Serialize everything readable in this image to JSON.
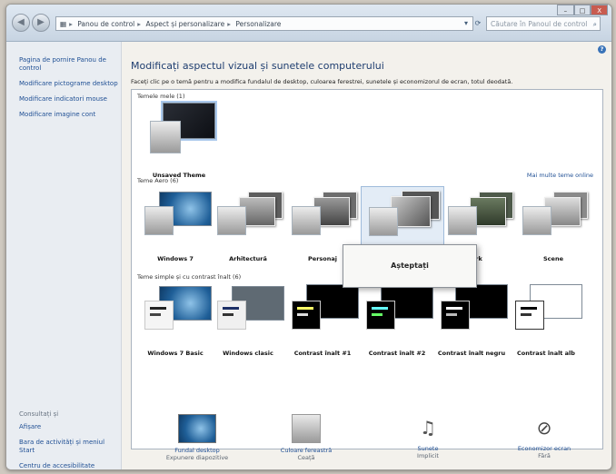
{
  "breadcrumb": [
    "Panou de control",
    "Aspect și personalizare",
    "Personalizare"
  ],
  "search": {
    "placeholder": "Căutare în Panoul de control"
  },
  "window_controls": [
    "–",
    "□",
    "X"
  ],
  "sidebar": {
    "links": [
      "Pagina de pornire Panou de control",
      "Modificare pictograme desktop",
      "Modificare indicatori mouse",
      "Modificare imagine cont"
    ],
    "see_also_title": "Consultați și",
    "see_also_links": [
      "Afișare",
      "Bara de activități și meniul Start",
      "Centru de accesibilitate"
    ]
  },
  "main": {
    "title": "Modificați aspectul vizual și sunetele computerului",
    "subtitle": "Faceți clic pe o temă pentru a modifica fundalul de desktop, culoarea ferestrei, sunetele și economizorul de ecran, totul deodată.",
    "my_themes_label": "Temele mele (1)",
    "aero_label": "Teme Aero (6)",
    "basic_label": "Teme simple și cu contrast înalt (6)",
    "more_themes_link": "Mai multe teme online",
    "my_themes": [
      {
        "name": "Unsaved Theme"
      }
    ],
    "aero_themes": [
      {
        "name": "Windows 7"
      },
      {
        "name": "Arhitectură"
      },
      {
        "name": "Personaj"
      },
      {
        "name": ""
      },
      {
        "name": "rk"
      },
      {
        "name": "Scene"
      }
    ],
    "basic_themes": [
      {
        "name": "Windows 7 Basic"
      },
      {
        "name": "Windows clasic"
      },
      {
        "name": "Contrast înalt #1"
      },
      {
        "name": "Contrast înalt #2"
      },
      {
        "name": "Contrast înalt negru"
      },
      {
        "name": "Contrast înalt alb"
      }
    ],
    "wait_dialog": "Așteptați"
  },
  "bottom": [
    {
      "label": "Fundal desktop",
      "value": "Expunere diapozitive",
      "icon": "desktop-background-icon"
    },
    {
      "label": "Culoare fereastră",
      "value": "Ceață",
      "icon": "window-color-icon"
    },
    {
      "label": "Sunete",
      "value": "Implicit",
      "icon": "sounds-icon"
    },
    {
      "label": "Economizor ecran",
      "value": "Fără",
      "icon": "screensaver-icon"
    }
  ]
}
